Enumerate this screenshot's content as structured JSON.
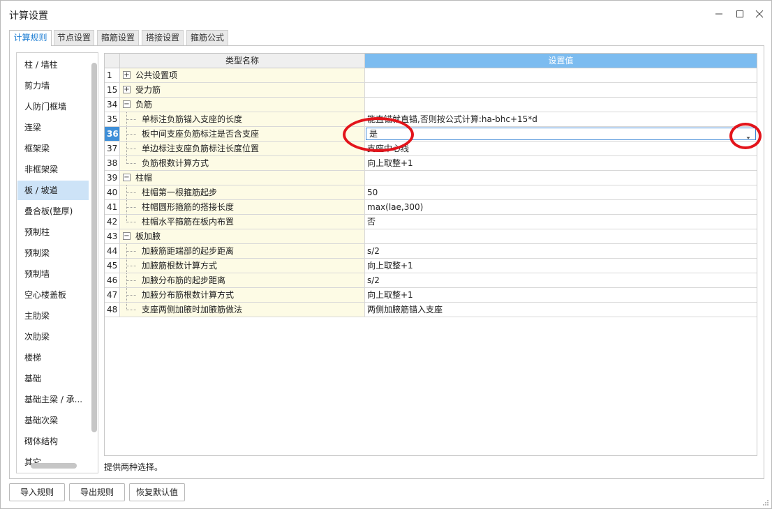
{
  "window": {
    "title": "计算设置"
  },
  "tabs": [
    {
      "label": "计算规则",
      "active": true
    },
    {
      "label": "节点设置"
    },
    {
      "label": "箍筋设置"
    },
    {
      "label": "搭接设置"
    },
    {
      "label": "箍筋公式"
    }
  ],
  "sidebar": {
    "items": [
      "柱 / 墙柱",
      "剪力墙",
      "人防门框墙",
      "连梁",
      "框架梁",
      "非框架梁",
      "板 / 坡道",
      "叠合板(整厚)",
      "预制柱",
      "预制梁",
      "预制墙",
      "空心楼盖板",
      "主肋梁",
      "次肋梁",
      "楼梯",
      "基础",
      "基础主梁 / 承...",
      "基础次梁",
      "砌体结构",
      "其它"
    ],
    "selected": "板 / 坡道"
  },
  "grid": {
    "headers": {
      "name": "类型名称",
      "value": "设置值"
    },
    "rows": [
      {
        "num": "1",
        "type": "group",
        "expanded": false,
        "toggle": "+",
        "name": "公共设置项",
        "value": ""
      },
      {
        "num": "15",
        "type": "group",
        "expanded": false,
        "toggle": "+",
        "name": "受力筋",
        "value": ""
      },
      {
        "num": "34",
        "type": "group",
        "expanded": true,
        "toggle": "−",
        "name": "负筋",
        "value": ""
      },
      {
        "num": "35",
        "type": "child",
        "name": "单标注负筋锚入支座的长度",
        "value": "能直锚就直锚,否则按公式计算:ha-bhc+15*d"
      },
      {
        "num": "36",
        "type": "child",
        "selected": true,
        "name": "板中间支座负筋标注是否含支座",
        "value": "是"
      },
      {
        "num": "37",
        "type": "child",
        "name": "单边标注支座负筋标注长度位置",
        "value": "支座中心线"
      },
      {
        "num": "38",
        "type": "child",
        "name": "负筋根数计算方式",
        "value": "向上取整+1"
      },
      {
        "num": "39",
        "type": "group",
        "expanded": true,
        "toggle": "−",
        "name": "柱帽",
        "value": ""
      },
      {
        "num": "40",
        "type": "child",
        "name": "柱帽第一根箍筋起步",
        "value": "50"
      },
      {
        "num": "41",
        "type": "child",
        "name": "柱帽圆形箍筋的搭接长度",
        "value": "max(lae,300)"
      },
      {
        "num": "42",
        "type": "child",
        "name": "柱帽水平箍筋在板内布置",
        "value": "否"
      },
      {
        "num": "43",
        "type": "group",
        "expanded": true,
        "toggle": "−",
        "name": "板加腋",
        "value": ""
      },
      {
        "num": "44",
        "type": "child",
        "name": "加腋筋距端部的起步距离",
        "value": "s/2"
      },
      {
        "num": "45",
        "type": "child",
        "name": "加腋筋根数计算方式",
        "value": "向上取整+1"
      },
      {
        "num": "46",
        "type": "child",
        "name": "加腋分布筋的起步距离",
        "value": "s/2"
      },
      {
        "num": "47",
        "type": "child",
        "name": "加腋分布筋根数计算方式",
        "value": "向上取整+1"
      },
      {
        "num": "48",
        "type": "child",
        "name": "支座两侧加腋时加腋筋做法",
        "value": "两侧加腋筋锚入支座"
      }
    ]
  },
  "status_text": "提供两种选择。",
  "buttons": {
    "import": "导入规则",
    "export": "导出规则",
    "restore": "恢复默认值"
  },
  "colors": {
    "accent": "#1e7ed3",
    "header_value_bg": "#7cbcf0",
    "name_cell_bg": "#fdfbe5",
    "selected_row_num_bg": "#3f8fd8",
    "annotation_ring": "#e3141b"
  },
  "icons": [
    "minimize-icon",
    "maximize-icon",
    "close-icon",
    "plus-box-icon",
    "minus-box-icon",
    "dropdown-arrow-icon",
    "resize-grip-icon"
  ]
}
